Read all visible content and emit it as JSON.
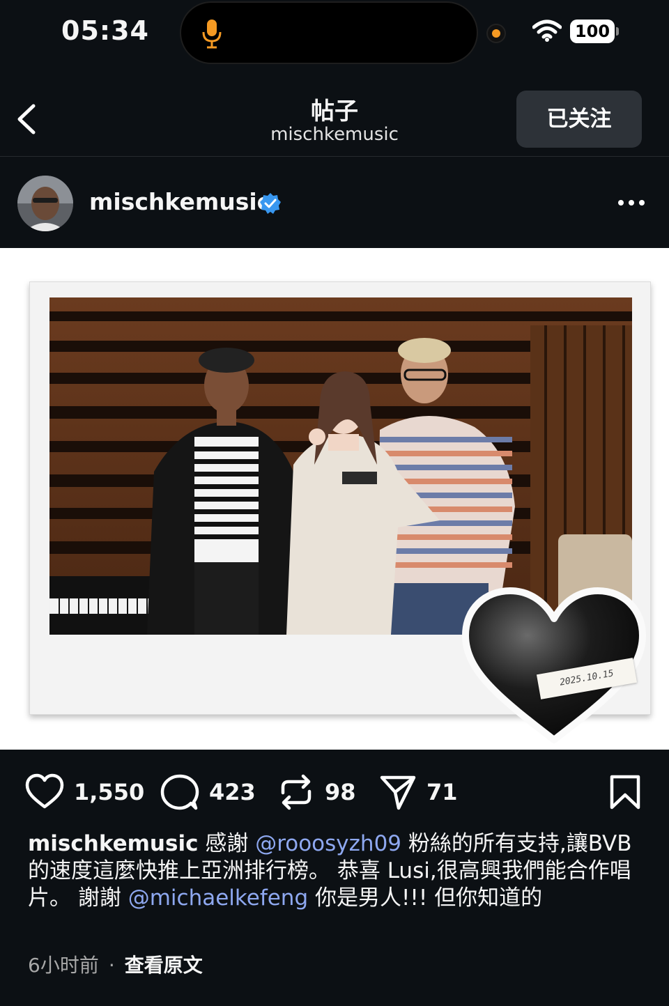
{
  "status_bar": {
    "time": "05:34",
    "battery": "100",
    "icons": [
      "microphone-icon",
      "wifi-icon",
      "battery-icon"
    ],
    "mic_color": "#f59a23"
  },
  "header": {
    "back_icon": "chevron-left-icon",
    "title": "帖子",
    "subtitle": "mischkemusic",
    "follow_label": "已关注"
  },
  "author": {
    "username": "mischkemusic",
    "verified_icon": "verified-badge-icon",
    "more_icon": "more-horizontal-icon"
  },
  "post_image": {
    "description_icon": "photo",
    "date_stamp": "2025.10.15",
    "sticker": "black-heart"
  },
  "actions": {
    "like_count": "1,550",
    "comment_count": "423",
    "repost_count": "98",
    "share_count": "71"
  },
  "caption": {
    "username": "mischkemusic",
    "text_1": " 感謝 ",
    "mention_1": "@rooosyzh09",
    "text_2": " 粉絲的所有支持,讓BVB 的速度這麼快推上亞洲排行榜。 恭喜 Lusi,很高興我們能合作唱片。 謝謝 ",
    "mention_2": "@michaelkefeng",
    "text_3": " 你是男人!!! 但你知道的"
  },
  "meta": {
    "time_ago": "6小时前",
    "separator": "·",
    "translate_label": "查看原文"
  },
  "colors": {
    "background": "#0c1014",
    "mention": "#8ea8f0",
    "verified": "#3897f0",
    "button": "#2d3238"
  }
}
